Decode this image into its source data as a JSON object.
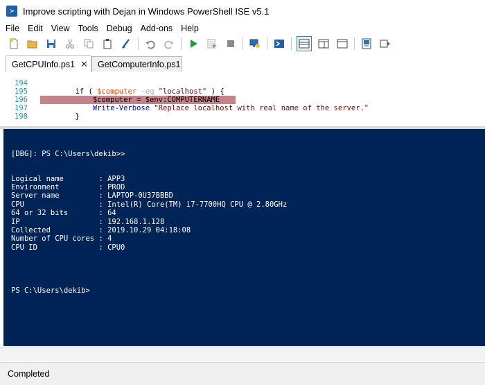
{
  "window": {
    "title": "Improve scripting with Dejan in Windows PowerShell ISE v5.1",
    "icon": "powershell-icon"
  },
  "menu": [
    "File",
    "Edit",
    "View",
    "Tools",
    "Debug",
    "Add-ons",
    "Help"
  ],
  "toolbar": {
    "icons": [
      "new-icon",
      "open-icon",
      "save-icon",
      "cut-icon",
      "copy-icon",
      "paste-icon",
      "clear-icon",
      "undo-icon",
      "redo-icon",
      "run-icon",
      "run-selection-icon",
      "stop-icon",
      "remote-powershell-icon",
      "powershell-console-icon",
      "layout-top-icon",
      "layout-right-icon",
      "layout-max-icon",
      "show-commands-icon",
      "show-addon-icon"
    ],
    "more": "⌄"
  },
  "tabs": [
    {
      "label": "GetCPUInfo.ps1",
      "active": true,
      "close": "✕"
    },
    {
      "label": "GetComputerInfo.ps1",
      "active": false
    }
  ],
  "editor": {
    "lines": [
      {
        "num": "194",
        "code": "        if ( $computer -eq \"localhost\" ) {"
      },
      {
        "num": "195",
        "code": "            $computer = $env:COMPUTERNAME",
        "highlight": true
      },
      {
        "num": "196",
        "code": "            Write-Verbose \"Replace localhost with real name of the server.\""
      },
      {
        "num": "197",
        "code": "        }"
      },
      {
        "num": "198",
        "code": ""
      }
    ]
  },
  "console": {
    "prompt_dbg": "[DBG]: PS C:\\Users\\dekib>>",
    "rows": [
      {
        "label": "Logical name        ",
        "value": "APP3"
      },
      {
        "label": "Environment         ",
        "value": "PROD"
      },
      {
        "label": "Server name         ",
        "value": "LAPTOP-0U37BBBD"
      },
      {
        "label": "CPU                 ",
        "value": "Intel(R) Core(TM) i7-7700HQ CPU @ 2.80GHz"
      },
      {
        "label": "64 or 32 bits       ",
        "value": "64"
      },
      {
        "label": "IP                  ",
        "value": "192.168.1.128"
      },
      {
        "label": "Collected           ",
        "value": "2019.10.29 04:18:08"
      },
      {
        "label": "Number of CPU cores ",
        "value": "4"
      },
      {
        "label": "CPU ID              ",
        "value": "CPU0"
      }
    ],
    "separator": ": ",
    "prompt": "PS C:\\Users\\dekib>"
  },
  "status": {
    "text": "Completed"
  },
  "colors": {
    "console_bg": "#012456",
    "highlight": "#c2838a",
    "line_numbers": "#2b91af"
  }
}
